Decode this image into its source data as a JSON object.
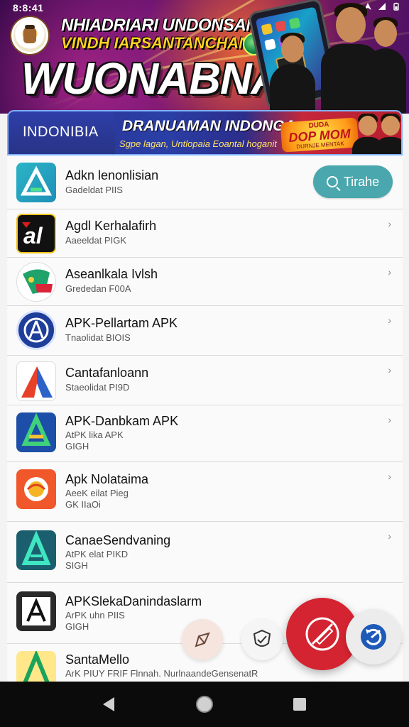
{
  "status_bar": {
    "time": "8:8:41",
    "icons": [
      "location-icon",
      "wifi-icon",
      "battery-icon"
    ]
  },
  "hero": {
    "tagline_1": "NHIADRIARI UNDONSAN",
    "tagline_2": "VINDH IARSANTANCHAN",
    "title": "WUONABNA"
  },
  "banner": {
    "left_label": "INDONIBIA",
    "title": "DRANUAMAN INDONGA",
    "subtitle": "Sgpe lagan, Untlopaia Eoantal hoganit",
    "promo": {
      "top": "DUDA",
      "main": "DOP MOM",
      "bottom": "DURNJE MENTAK"
    }
  },
  "apps": [
    {
      "title": "Adkn lenonlisian",
      "sub": [
        "Gadeldat PIIS"
      ],
      "action": "Tirahe",
      "icon": "apk-triangle-teal-icon"
    },
    {
      "title": "Agdl Kerhalafirh",
      "sub": [
        "Aaeeldat PIGK"
      ],
      "icon": "red-a-logo-icon"
    },
    {
      "title": "Aseanlkala Ivlsh",
      "sub": [
        "Grededan F00A"
      ],
      "icon": "map-shield-icon"
    },
    {
      "title": "APK-Pellartam APK",
      "sub": [
        "Tnaolidat BIOIS"
      ],
      "icon": "blue-circle-a-icon"
    },
    {
      "title": "Cantafanloann",
      "sub": [
        "Staeolidat PI9D"
      ],
      "icon": "red-blue-a-icon"
    },
    {
      "title": "APK-Danbkam APK",
      "sub": [
        "AtPK lika APK",
        "GIGH"
      ],
      "icon": "blue-green-a-icon"
    },
    {
      "title": "Apk Nolataima",
      "sub": [
        "AeeK eilat Pieg",
        "GK IIaOi"
      ],
      "icon": "orange-circle-icon"
    },
    {
      "title": "CanaeSendvaning",
      "sub": [
        "AtPK elat PIKD",
        "SIGH"
      ],
      "icon": "teal-a-icon"
    },
    {
      "title": "APKSlekaDanindaslarm",
      "sub": [
        "ArPK uhn PIIS",
        "GIGH"
      ],
      "icon": "sketch-a-icon"
    },
    {
      "title": "SantaMello",
      "sub": [
        "ArK PIUY FRIF Flnnah. NurlnaandeGensenatR"
      ],
      "icon": "green-a-icon"
    }
  ],
  "fabs": [
    "share-icon",
    "shield-check-icon",
    "no-edit-icon",
    "refresh-icon"
  ],
  "nav": [
    "back-icon",
    "home-icon",
    "recents-icon"
  ],
  "colors": {
    "accent": "#4aa7ad",
    "fab": "#d42431",
    "banner": "#2a3fa6"
  }
}
